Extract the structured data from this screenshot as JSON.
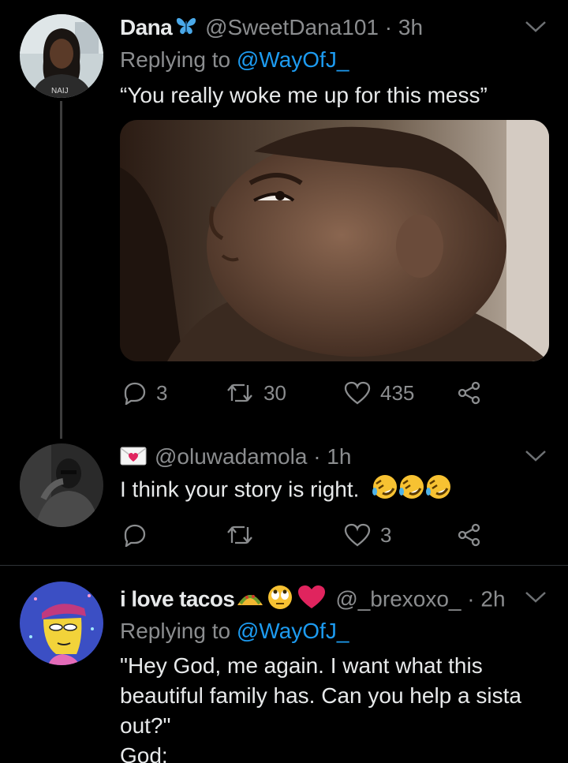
{
  "tweets": [
    {
      "display_name": "Dana",
      "name_emoji": "butterfly",
      "handle": "@SweetDana101",
      "time": "· 3h",
      "replying_label": "Replying to",
      "replying_to": "@WayOfJ_",
      "text": "“You really woke me up for this mess”",
      "media": "photo-baby-looking-sideways",
      "reply_count": "3",
      "retweet_count": "30",
      "like_count": "435"
    },
    {
      "name_emoji": "love-letter",
      "handle": "@oluwadamola",
      "time": "· 1h",
      "text": "I think your story is right.",
      "text_emojis": [
        "rolling-on-floor-laughing",
        "rolling-on-floor-laughing",
        "rolling-on-floor-laughing"
      ],
      "reply_count": "",
      "retweet_count": "",
      "like_count": "3"
    },
    {
      "display_name": "i love tacos",
      "name_emojis": [
        "taco",
        "face-with-rolling-eyes",
        "red-heart"
      ],
      "handle": "@_brexoxo_",
      "time": "· 2h",
      "replying_label": "Replying to",
      "replying_to": "@WayOfJ_",
      "text_lines": [
        "\"Hey God, me again. I want what this",
        "beautiful family has. Can you help a sista",
        "out?\"",
        "God:"
      ]
    }
  ],
  "colors": {
    "background": "#000000",
    "primary_text": "#e7e9ea",
    "secondary_text": "#8b8d8f",
    "link": "#1d9bf0",
    "butterfly": "#4aa8e8",
    "heart": "#e0245e",
    "thread_line": "#3d3d3d"
  }
}
